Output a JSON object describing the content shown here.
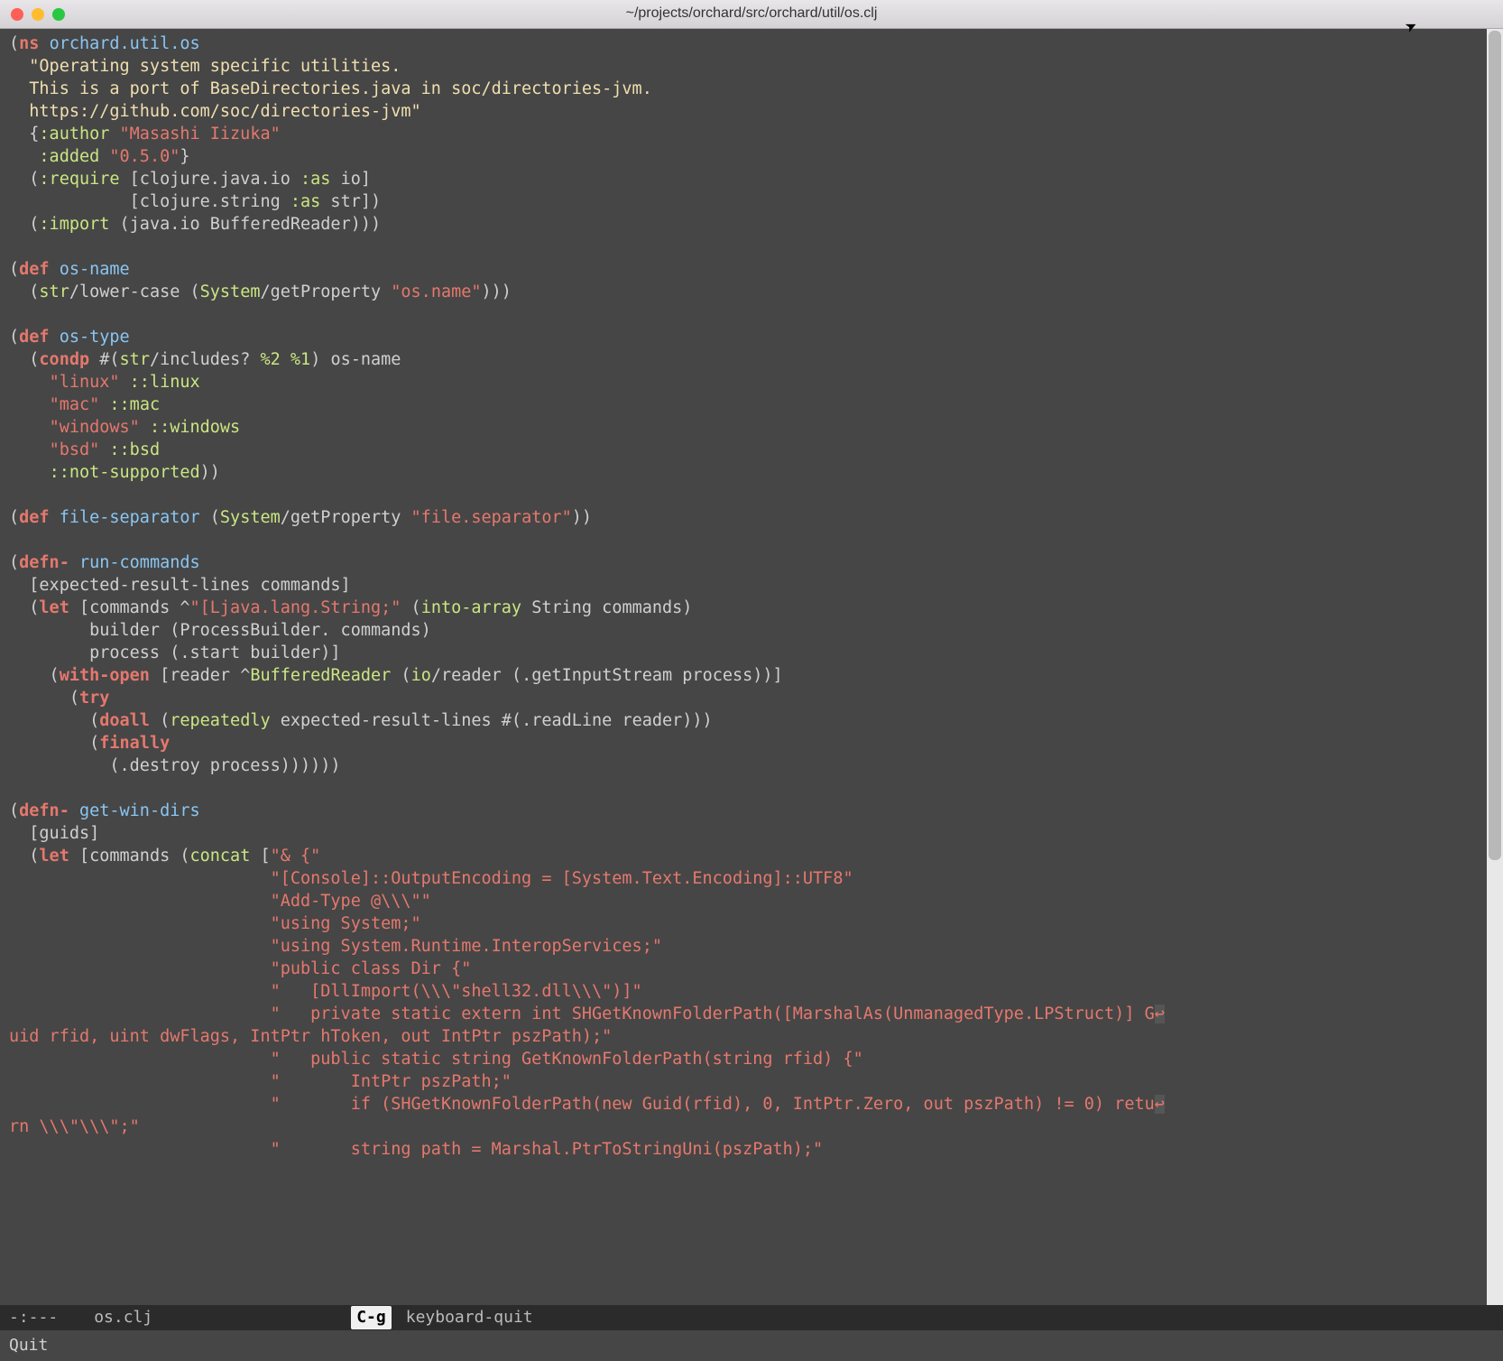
{
  "titlebar": {
    "path": "~/projects/orchard/src/orchard/util/os.clj"
  },
  "modeline": {
    "left": "-:---",
    "file": "os.clj",
    "key": "C-g",
    "command": "keyboard-quit"
  },
  "minibuffer": {
    "text": "Quit"
  },
  "code": {
    "line1_ns": "ns",
    "line1_name": "orchard.util.os",
    "line2": "  \"Operating system specific utilities.",
    "line3": "  This is a port of BaseDirectories.java in soc/directories-jvm.",
    "line4": "  https://github.com/soc/directories-jvm\"",
    "line5a": "  {",
    "line5_author_k": ":author",
    "line5_author_v": "\"Masashi Iizuka\"",
    "line6_added_k": ":added",
    "line6_added_v": "\"0.5.0\"",
    "line6b": "}",
    "line7a": "  (",
    "line7_require": ":require",
    "line7b": " [clojure.java.io ",
    "line7_as1": ":as",
    "line7c": " io]",
    "line8a": "            [clojure.string ",
    "line8_as2": ":as",
    "line8b": " str])",
    "line9a": "  (",
    "line9_import": ":import",
    "line9b": " (java.io BufferedReader)))",
    "blank1": "",
    "line10a": "(",
    "line10_def": "def",
    "line10_name": "os-name",
    "line11a": "  (",
    "line11_ns": "str",
    "line11b": "/lower-case (",
    "line11_sys": "System",
    "line11c": "/getProperty ",
    "line11_str": "\"os.name\"",
    "line11d": ")))",
    "blank2": "",
    "line12a": "(",
    "line12_def": "def",
    "line12_name": "os-type",
    "line13a": "  (",
    "line13_condp": "condp",
    "line13b": " #(",
    "line13_ns": "str",
    "line13c": "/includes? ",
    "line13_args": "%2 %1",
    "line13d": ") os-name",
    "line14a": "    ",
    "line14_s": "\"linux\"",
    "line14_k": " ::linux",
    "line15a": "    ",
    "line15_s": "\"mac\"",
    "line15_k": " ::mac",
    "line16a": "    ",
    "line16_s": "\"windows\"",
    "line16_k": " ::windows",
    "line17a": "    ",
    "line17_s": "\"bsd\"",
    "line17_k": " ::bsd",
    "line18a": "    ",
    "line18_k": "::not-supported",
    "line18b": "))",
    "blank3": "",
    "line19a": "(",
    "line19_def": "def",
    "line19_name": "file-separator",
    "line19b": " (",
    "line19_sys": "System",
    "line19c": "/getProperty ",
    "line19_s": "\"file.separator\"",
    "line19d": "))",
    "blank4": "",
    "line20a": "(",
    "line20_defn": "defn-",
    "line20_name": "run-commands",
    "line21": "  [expected-result-lines commands]",
    "line22a": "  (",
    "line22_let": "let",
    "line22b": " [commands ^",
    "line22_hint": "\"[Ljava.lang.String;\"",
    "line22c": " (",
    "line22_ia": "into-array",
    "line22d": " String commands)",
    "line23": "        builder (ProcessBuilder. commands)",
    "line24": "        process (.start builder)]",
    "line25a": "    (",
    "line25_wo": "with-open",
    "line25b": " [reader ^",
    "line25_ty": "BufferedReader",
    "line25c": " (",
    "line25_ns": "io",
    "line25d": "/reader (.getInputStream process))]",
    "line26a": "      (",
    "line26_try": "try",
    "line27a": "        (",
    "line27_doall": "doall",
    "line27b": " (",
    "line27_rep": "repeatedly",
    "line27c": " expected-result-lines #(.readLine reader)))",
    "line28a": "        (",
    "line28_fin": "finally",
    "line29": "          (.destroy process))))))",
    "blank5": "",
    "line30a": "(",
    "line30_defn": "defn-",
    "line30_name": "get-win-dirs",
    "line31": "  [guids]",
    "line32a": "  (",
    "line32_let": "let",
    "line32b": " [commands (",
    "line32_concat": "concat",
    "line32c": " [",
    "line32_s1": "\"& {\"",
    "line33a": "                          ",
    "line33_s": "\"[Console]::OutputEncoding = [System.Text.Encoding]::UTF8\"",
    "line34a": "                          ",
    "line34_s": "\"Add-Type @\\\\\\\"\"",
    "line35a": "                          ",
    "line35_s": "\"using System;\"",
    "line36a": "                          ",
    "line36_s": "\"using System.Runtime.InteropServices;\"",
    "line37a": "                          ",
    "line37_s": "\"public class Dir {\"",
    "line38a": "                          ",
    "line38_s": "\"   [DllImport(\\\\\\\"shell32.dll\\\\\\\")]\"",
    "line39a": "                          ",
    "line39_s": "\"   private static extern int SHGetKnownFolderPath([MarshalAs(UnmanagedType.LPStruct)] G",
    "line39wrap1": "↩",
    "line39cont_a": "uid rfid, uint dwFlags, IntPtr hToken, out IntPtr pszPath);\"",
    "line40a": "                          ",
    "line40_s": "\"   public static string GetKnownFolderPath(string rfid) {\"",
    "line41a": "                          ",
    "line41_s": "\"       IntPtr pszPath;\"",
    "line42a": "                          ",
    "line42_s": "\"       if (SHGetKnownFolderPath(new Guid(rfid), 0, IntPtr.Zero, out pszPath) != 0) retu",
    "line42wrap": "↩",
    "line42cont": "rn \\\\\\\"\\\\\\\";\"",
    "line43a": "                          ",
    "line43_s": "\"       string path = Marshal.PtrToStringUni(pszPath);\""
  }
}
